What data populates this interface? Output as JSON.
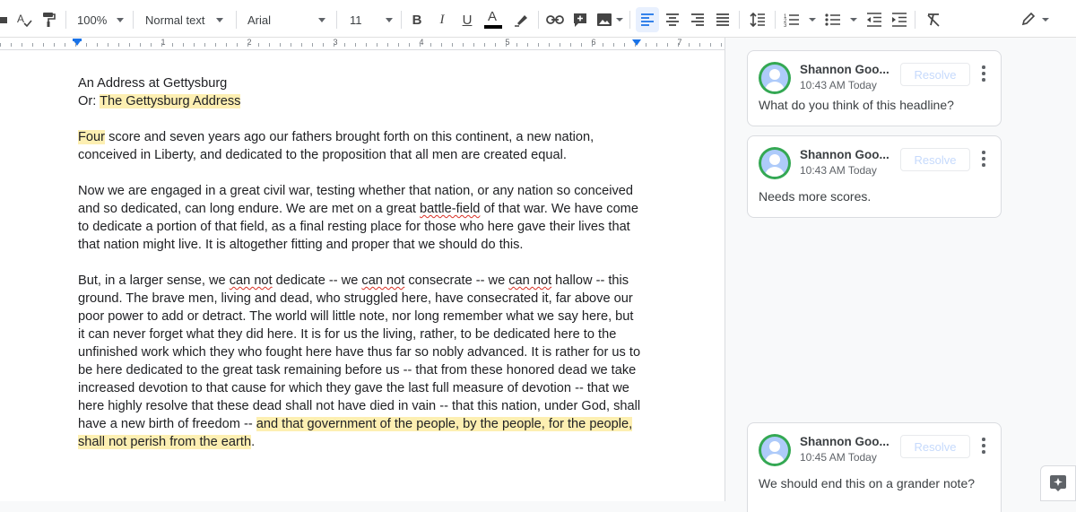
{
  "toolbar": {
    "zoom": "100%",
    "style": "Normal text",
    "font": "Arial",
    "font_size": "11"
  },
  "ruler": {
    "numbers": [
      "1",
      "2",
      "3",
      "4",
      "5",
      "6",
      "7"
    ]
  },
  "document": {
    "title_line1": "An Address at Gettysburg",
    "title_line2_prefix": "Or: ",
    "title_line2_highlight": "The Gettysburg Address",
    "p1_highlight": "Four",
    "p1_rest": " score and seven years ago our fathers brought forth on this continent, a new nation, conceived in Liberty, and dedicated to the proposition that all men are created equal.",
    "p2_a": "Now we are engaged in a great civil war, testing whether that nation, or any nation so conceived and so dedicated, can long endure. We are met on a great ",
    "p2_sq": "battle-field",
    "p2_b": " of that war. We have come to dedicate a portion of that field, as a final resting place for those who here gave their lives that that nation might live. It is altogether fitting and proper that we should do this.",
    "p3_a": "But, in a larger sense, we ",
    "p3_sq": "can not",
    "p3_b": " dedicate -- we ",
    "p3_c": " consecrate -- we ",
    "p3_d": " hallow -- this ground. The brave men, living and dead, who struggled here, have consecrated it, far above our poor power to add or detract. The world will little note, nor long remember what we say here, but it can never forget what they did here. It is for us the living, rather, to be dedicated here to the unfinished work which they who fought here have thus far so nobly advanced. It is rather for us to be here dedicated to the great task remaining before us -- that from these honored dead we take increased devotion to that cause for which they gave the last full measure of devotion -- that we here highly resolve that these dead shall not have died in vain -- that this nation, under God, shall have a new birth of freedom -- ",
    "p3_highlight": "and that government of the people, by the people, for the people, shall not perish from the earth",
    "p3_end": "."
  },
  "comments": [
    {
      "author": "Shannon Goo...",
      "time": "10:43 AM Today",
      "resolve": "Resolve",
      "text": "What do you think of this headline?"
    },
    {
      "author": "Shannon Goo...",
      "time": "10:43 AM Today",
      "resolve": "Resolve",
      "text": "Needs more scores."
    },
    {
      "author": "Shannon Goo...",
      "time": "10:45 AM Today",
      "resolve": "Resolve",
      "text": "We should end this on a grander note?"
    }
  ],
  "icons": {
    "spellcheck": "spellcheck-icon",
    "paint_format": "paint-format-icon",
    "bold": "bold-icon",
    "italic": "italic-icon",
    "underline": "underline-icon",
    "text_color": "text-color-icon",
    "highlight": "highlight-color-icon",
    "link": "link-icon",
    "comment": "add-comment-icon",
    "image": "insert-image-icon",
    "align_left": "align-left-icon",
    "align_center": "align-center-icon",
    "align_right": "align-right-icon",
    "justify": "justify-icon",
    "line_spacing": "line-spacing-icon",
    "numbered_list": "numbered-list-icon",
    "bulleted_list": "bulleted-list-icon",
    "decrease_indent": "decrease-indent-icon",
    "increase_indent": "increase-indent-icon",
    "clear_format": "clear-formatting-icon",
    "editing_mode": "pencil-icon",
    "explore": "explore-icon"
  },
  "colors": {
    "highlight": "#fdefb2",
    "accent": "#1a73e8",
    "text_color_bar": "#000000",
    "avatar_ring": "#34a853"
  }
}
